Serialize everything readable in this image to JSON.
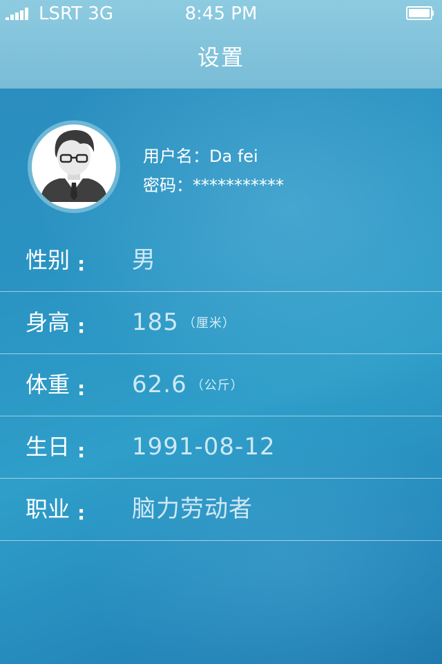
{
  "status_bar": {
    "carrier": "LSRT 3G",
    "time": "8:45 PM",
    "signal_icon": "signal-bars-icon",
    "battery_icon": "battery-icon"
  },
  "nav": {
    "title": "设置"
  },
  "profile": {
    "avatar_icon": "businessman-avatar-icon",
    "username_label": "用户名：",
    "username": "Da fei",
    "password_label": "密码：",
    "password": "***********"
  },
  "fields": [
    {
      "label": "性别",
      "colon": ":",
      "value": "男",
      "unit": ""
    },
    {
      "label": "身高",
      "colon": ":",
      "value": "185",
      "unit": "（厘米）"
    },
    {
      "label": "体重",
      "colon": ":",
      "value": "62.6",
      "unit": "（公斤）"
    },
    {
      "label": "生日",
      "colon": ":",
      "value": "1991-08-12",
      "unit": ""
    },
    {
      "label": "职业",
      "colon": ":",
      "value": "脑力劳动者",
      "unit": ""
    }
  ],
  "colors": {
    "background": "#2a93c2",
    "header": "#85c5dd",
    "value_text": "#cfe8f4"
  }
}
